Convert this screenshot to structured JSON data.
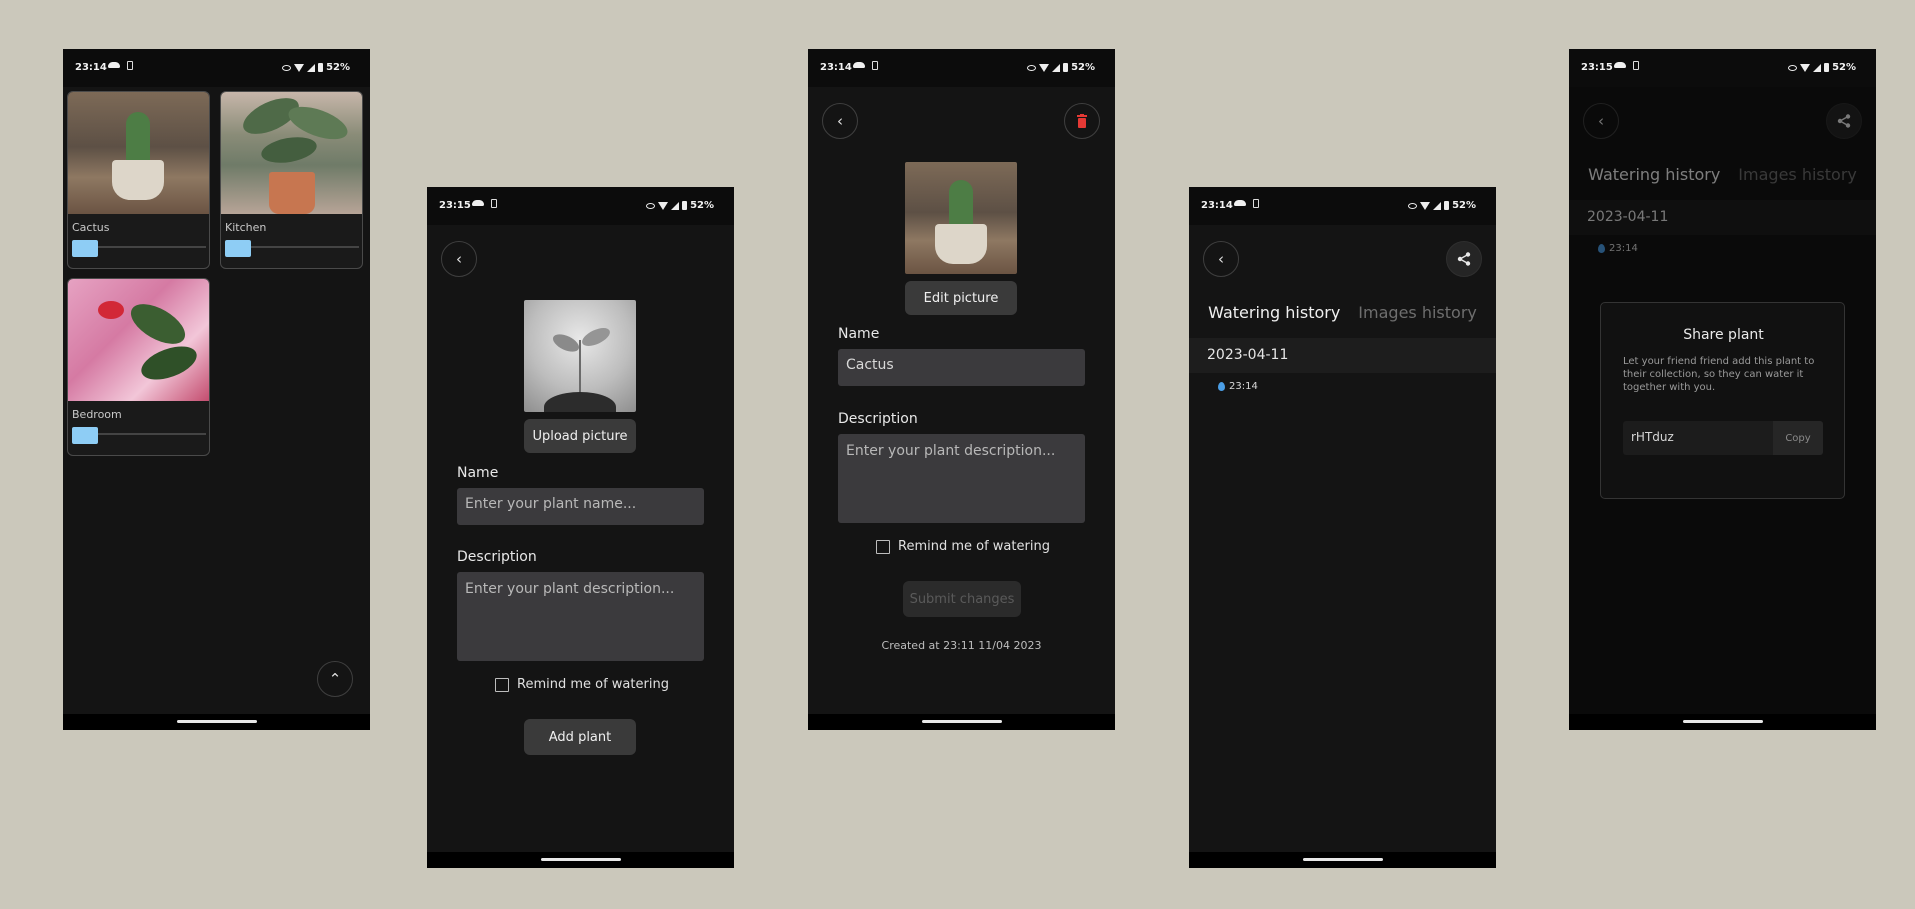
{
  "colors": {
    "background": "#cbc8bb",
    "screen": "#141414",
    "accent_water": "#8ecdf5",
    "delete": "#e53935"
  },
  "screens": {
    "collection": {
      "status": {
        "time": "23:14",
        "battery": "52%"
      },
      "plants": [
        {
          "name": "Cactus",
          "water_level": 0.18
        },
        {
          "name": "Kitchen",
          "water_level": 0.18
        },
        {
          "name": "Bedroom",
          "water_level": 0.18
        }
      ],
      "scroll_top_icon": "chevron-up-icon"
    },
    "add_plant": {
      "status": {
        "time": "23:15",
        "battery": "52%"
      },
      "upload_label": "Upload picture",
      "name_label": "Name",
      "name_placeholder": "Enter your plant name...",
      "description_label": "Description",
      "description_placeholder": "Enter your plant description...",
      "remind_label": "Remind me of watering",
      "submit_label": "Add plant"
    },
    "edit_plant": {
      "status": {
        "time": "23:14",
        "battery": "52%"
      },
      "edit_picture_label": "Edit picture",
      "name_label": "Name",
      "name_value": "Cactus",
      "description_label": "Description",
      "description_placeholder": "Enter your plant description...",
      "remind_label": "Remind me of watering",
      "submit_label": "Submit changes",
      "created_text": "Created at 23:11 11/04 2023"
    },
    "history": {
      "status": {
        "time": "23:14",
        "battery": "52%"
      },
      "tabs": [
        "Watering history",
        "Images history"
      ],
      "date": "2023-04-11",
      "entry_time": "23:14"
    },
    "share": {
      "status": {
        "time": "23:15",
        "battery": "52%"
      },
      "tabs": [
        "Watering history",
        "Images history"
      ],
      "date": "2023-04-11",
      "entry_time": "23:14",
      "dialog": {
        "title": "Share plant",
        "text": "Let your friend friend add this plant to their collection, so they can water it together with you.",
        "code": "rHTduz",
        "copy_label": "Copy"
      }
    }
  }
}
